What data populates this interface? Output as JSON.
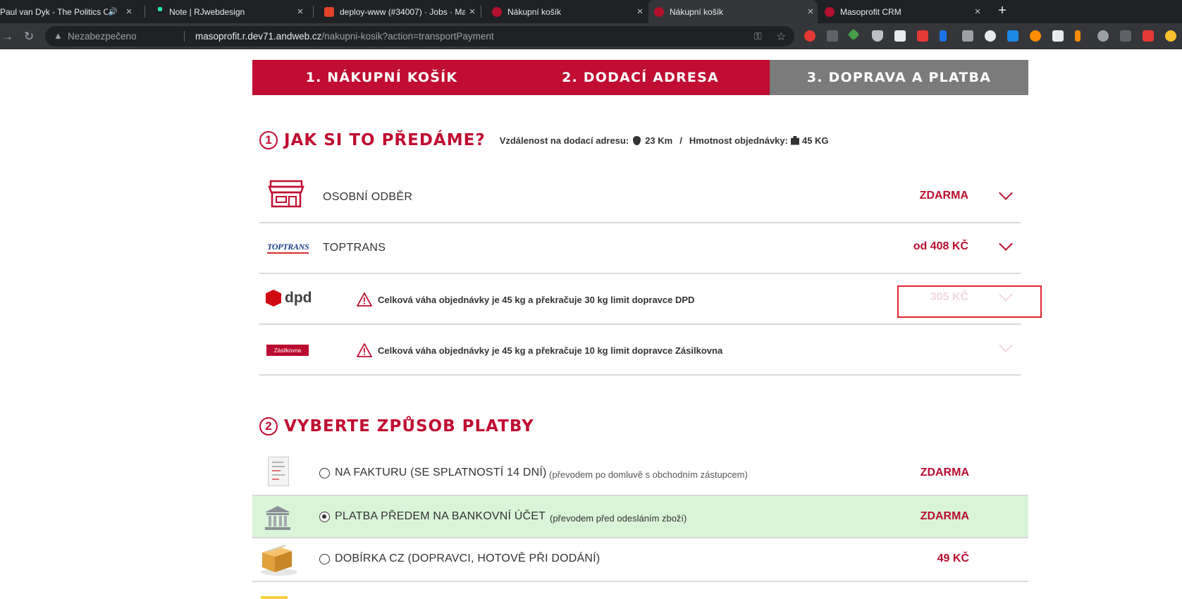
{
  "browser": {
    "tabs": [
      {
        "title": "Paul van Dyk - The Politics O",
        "audio": true
      },
      {
        "title": "Note | RJwebdesign"
      },
      {
        "title": "deploy-www (#34007) · Jobs · Ma"
      },
      {
        "title": "Nákupní košík"
      },
      {
        "title": "Nákupní košík",
        "active": true
      },
      {
        "title": "Masoprofit CRM"
      }
    ],
    "security_label": "Nezabezpečeno",
    "url_host": "masoprofit.r.dev71.andweb.cz",
    "url_path": "/nakupni-kosik?action=transportPayment"
  },
  "steps": [
    {
      "label": "1. NÁKUPNÍ KOŠÍK"
    },
    {
      "label": "2. DODACÍ ADRESA"
    },
    {
      "label": "3. DOPRAVA A PLATBA"
    }
  ],
  "section1": {
    "num": "1",
    "title": "JAK SI TO PŘEDÁME?",
    "distance_label": "Vzdálenost na dodací adresu:",
    "distance_value": "23 Km",
    "separator": "/",
    "weight_label": "Hmotnost objednávky:",
    "weight_value": "45 KG"
  },
  "shipping": [
    {
      "label": "OSOBNÍ ODBĚR",
      "price": "ZDARMA"
    },
    {
      "label": "TOPTRANS",
      "logo_text": "TOPTRANS",
      "price": "od 408 KČ"
    },
    {
      "logo_text": "dpd",
      "warning": "Celková váha objednávky je 45 kg a překračuje 30 kg limit dopravce DPD",
      "price": "305 KČ",
      "disabled": true
    },
    {
      "logo_text": "Zásilkovna",
      "warning": "Celková váha objednávky je 45 kg a překračuje 10 kg limit dopravce Zásilkovna",
      "price": "",
      "disabled": true
    }
  ],
  "section2": {
    "num": "2",
    "title": "VYBERTE ZPŮSOB PLATBY"
  },
  "payment": [
    {
      "label": "NA FAKTURU (SE SPLATNOSTÍ 14 DNÍ)",
      "note": "(převodem po domluvě s obchodním zástupcem)",
      "price": "ZDARMA",
      "selected": false
    },
    {
      "label": "PLATBA PŘEDEM NA BANKOVNÍ ÚČET",
      "note": "(převodem před odesláním zboží)",
      "price": "ZDARMA",
      "selected": true
    },
    {
      "label": "DOBÍRKA CZ (DOPRAVCI, HOTOVĚ PŘI DODÁNÍ)",
      "note": "",
      "price": "49 KČ",
      "selected": false
    }
  ],
  "colors": {
    "brand": "#c00d31",
    "inactive_step": "#7b7b7b",
    "selected_row": "#d9f5d8"
  }
}
